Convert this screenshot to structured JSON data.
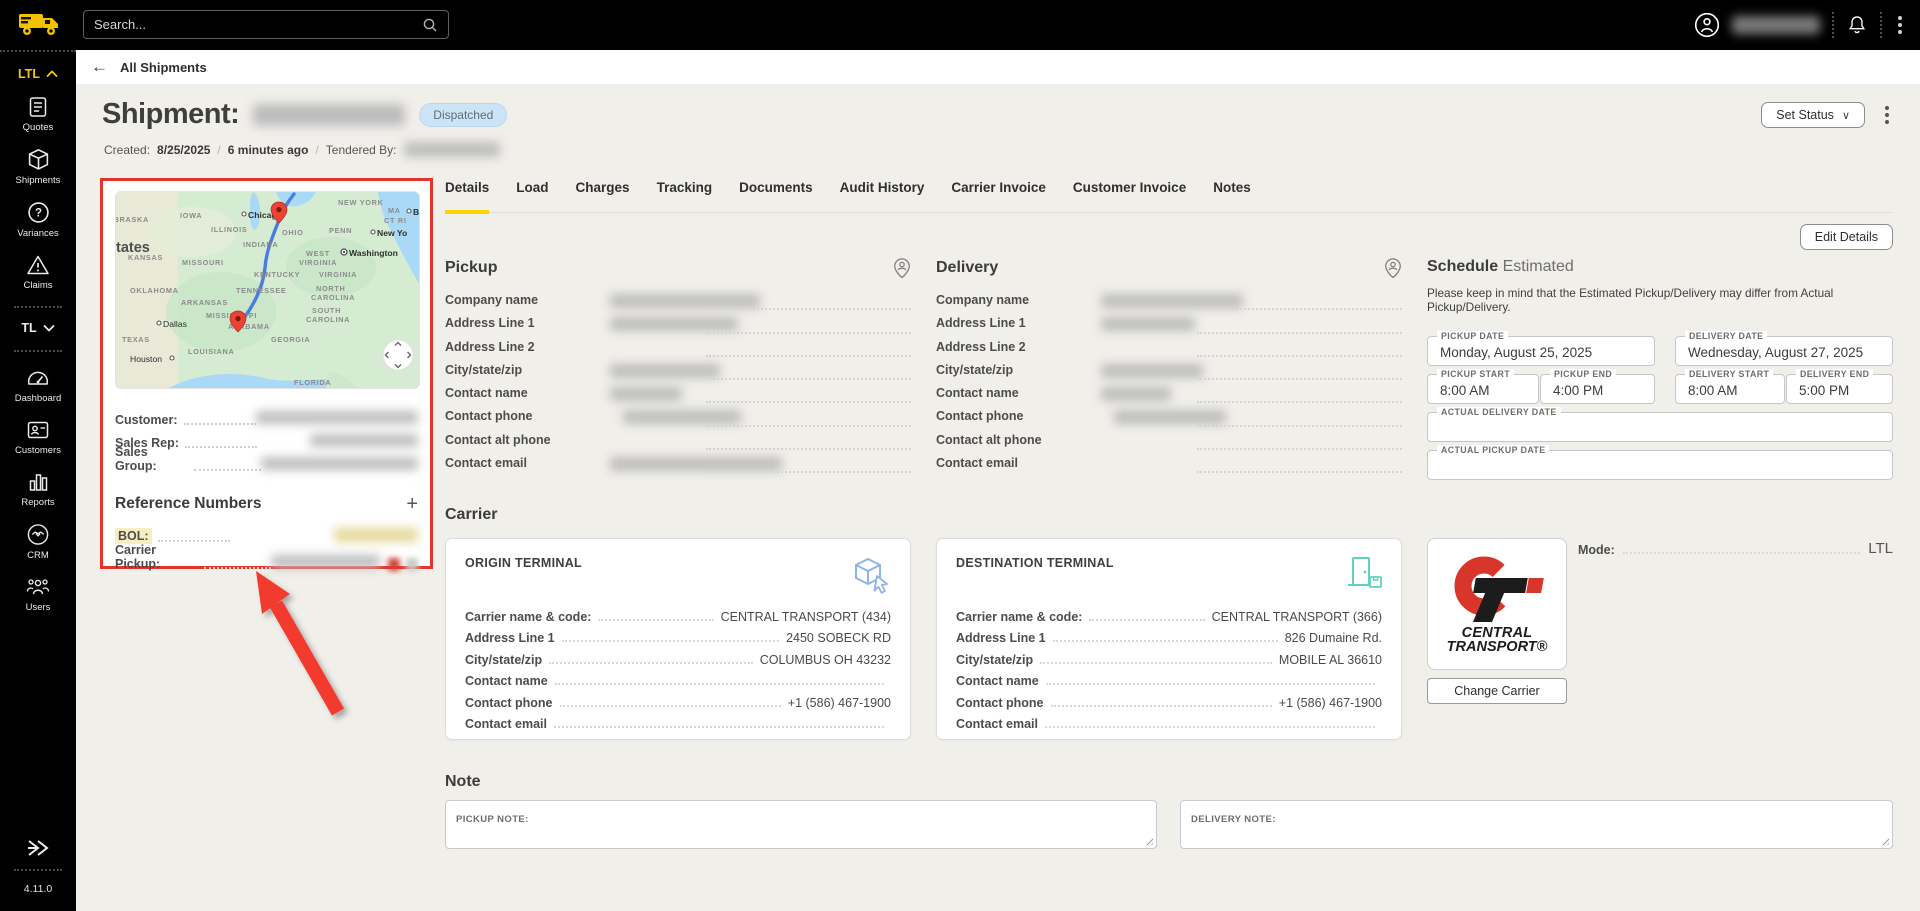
{
  "topbar": {
    "search_placeholder": "Search...",
    "user_redacted": true
  },
  "sidebar": {
    "ltl_label": "LTL",
    "tl_label": "TL",
    "items": [
      {
        "label": "Quotes"
      },
      {
        "label": "Shipments"
      },
      {
        "label": "Variances"
      },
      {
        "label": "Claims"
      },
      {
        "label": "Dashboard"
      },
      {
        "label": "Customers"
      },
      {
        "label": "Reports"
      },
      {
        "label": "CRM"
      },
      {
        "label": "Users"
      }
    ],
    "version": "4.11.0"
  },
  "breadcrumb": {
    "back": "←",
    "label": "All Shipments"
  },
  "header": {
    "title": "Shipment:",
    "id_redacted": true,
    "status_badge": "Dispatched",
    "created_label": "Created:",
    "created_date": "8/25/2025",
    "separator": "/",
    "created_ago": "6 minutes ago",
    "tendered_label": "Tendered By:",
    "set_status_label": "Set Status",
    "set_status_chevron": "∨"
  },
  "tabs": {
    "active": "Details",
    "items": [
      {
        "label": "Details"
      },
      {
        "label": "Load"
      },
      {
        "label": "Charges"
      },
      {
        "label": "Tracking"
      },
      {
        "label": "Documents"
      },
      {
        "label": "Audit History"
      },
      {
        "label": "Carrier Invoice"
      },
      {
        "label": "Customer Invoice"
      },
      {
        "label": "Notes"
      }
    ]
  },
  "details_actions": {
    "edit_details_label": "Edit Details"
  },
  "left_panel": {
    "info_rows": [
      {
        "label": "Customer:",
        "redacted": true
      },
      {
        "label": "Sales Rep:",
        "redacted": true
      },
      {
        "label": "Sales Group:",
        "redacted": true
      }
    ],
    "reference": {
      "title": "Reference Numbers",
      "add_icon": "+",
      "rows": [
        {
          "label": "BOL:",
          "highlight": true,
          "redacted": true
        },
        {
          "label": "Carrier Pickup:",
          "redacted": true
        }
      ]
    }
  },
  "map": {
    "labels": {
      "nebraska": "NEBRASKA",
      "iowa": "IOWA",
      "illinois": "ILLINOIS",
      "indiana": "INDIANA",
      "ohio": "OHIO",
      "penn": "PENN",
      "new_york_state": "NEW YORK",
      "ma": "MA",
      "ct_ri": "CT RI",
      "united_states_cut": "tates",
      "kansas": "KANSAS",
      "missouri": "MISSOURI",
      "west1": "WEST",
      "west2": "VIRGINIA",
      "kentucky": "KENTUCKY",
      "virginia": "VIRGINIA",
      "oklahoma": "OKLAHOMA",
      "tennessee": "TENNESSEE",
      "nc1": "NORTH",
      "nc2": "CAROLINA",
      "arkansas": "ARKANSAS",
      "sc1": "SOUTH",
      "sc2": "CAROLINA",
      "mississippi": "MISSISSIPPI",
      "alabama": "ALABAMA",
      "georgia": "GEORGIA",
      "texas": "TEXAS",
      "louisiana": "LOUISIANA",
      "florida": "FLORIDA"
    },
    "cities": {
      "chicago": "Chicago",
      "washington": "Washington",
      "new_york": "New Yo",
      "boston": "B",
      "dallas": "Dallas",
      "houston": "Houston"
    }
  },
  "pickup": {
    "title": "Pickup",
    "fields": [
      {
        "label": "Company name",
        "redacted": true
      },
      {
        "label": "Address Line 1",
        "redacted": true
      },
      {
        "label": "Address Line 2",
        "redacted": false
      },
      {
        "label": "City/state/zip",
        "redacted": true
      },
      {
        "label": "Contact name",
        "redacted": true
      },
      {
        "label": "Contact phone",
        "redacted": true
      },
      {
        "label": "Contact alt phone",
        "redacted": false
      },
      {
        "label": "Contact email",
        "redacted": true
      }
    ]
  },
  "delivery": {
    "title": "Delivery",
    "fields": [
      {
        "label": "Company name",
        "redacted": true
      },
      {
        "label": "Address Line 1",
        "redacted": true
      },
      {
        "label": "Address Line 2",
        "redacted": false
      },
      {
        "label": "City/state/zip",
        "redacted": true
      },
      {
        "label": "Contact name",
        "redacted": true
      },
      {
        "label": "Contact phone",
        "redacted": true
      },
      {
        "label": "Contact alt phone",
        "redacted": false
      },
      {
        "label": "Contact email",
        "redacted": false
      }
    ]
  },
  "schedule": {
    "title": "Schedule",
    "subtitle": "Estimated",
    "disclaimer": "Please keep in mind that the Estimated Pickup/Delivery may differ from Actual Pickup/Delivery.",
    "pickup_date": {
      "label": "PICKUP DATE",
      "value": "Monday, August 25, 2025"
    },
    "delivery_date": {
      "label": "DELIVERY DATE",
      "value": "Wednesday, August 27, 2025"
    },
    "pickup_start": {
      "label": "PICKUP START",
      "value": "8:00 AM"
    },
    "pickup_end": {
      "label": "PICKUP END",
      "value": "4:00 PM"
    },
    "delivery_start": {
      "label": "DELIVERY START",
      "value": "8:00 AM"
    },
    "delivery_end": {
      "label": "DELIVERY END",
      "value": "5:00 PM"
    },
    "actual_delivery_date": {
      "label": "ACTUAL DELIVERY DATE",
      "value": ""
    },
    "actual_pickup_date": {
      "label": "ACTUAL PICKUP DATE",
      "value": ""
    }
  },
  "carrier": {
    "title": "Carrier",
    "origin": {
      "heading": "ORIGIN TERMINAL",
      "rows": [
        {
          "label": "Carrier name & code:",
          "value": "CENTRAL TRANSPORT (434)"
        },
        {
          "label": "Address Line 1",
          "value": "2450 SOBECK RD"
        },
        {
          "label": "City/state/zip",
          "value": "COLUMBUS OH 43232"
        },
        {
          "label": "Contact name",
          "value": ""
        },
        {
          "label": "Contact phone",
          "value": "+1 (586) 467-1900"
        },
        {
          "label": "Contact email",
          "value": ""
        }
      ]
    },
    "destination": {
      "heading": "DESTINATION TERMINAL",
      "rows": [
        {
          "label": "Carrier name & code:",
          "value": "CENTRAL TRANSPORT (366)"
        },
        {
          "label": "Address Line 1",
          "value": "826 Dumaine Rd."
        },
        {
          "label": "City/state/zip",
          "value": "MOBILE AL 36610"
        },
        {
          "label": "Contact name",
          "value": ""
        },
        {
          "label": "Contact phone",
          "value": "+1 (586) 467-1900"
        },
        {
          "label": "Contact email",
          "value": ""
        }
      ]
    },
    "logo": {
      "line1": "CENTRAL",
      "line2": "TRANSPORT®"
    },
    "change_carrier_label": "Change Carrier",
    "mode_label": "Mode:",
    "mode_value": "LTL"
  },
  "note": {
    "title": "Note",
    "pickup_label": "PICKUP NOTE:",
    "delivery_label": "DELIVERY NOTE:"
  },
  "colors": {
    "accent_yellow": "#ffd400",
    "alert_red": "#e5352b",
    "badge_blue_bg": "#cde4f6",
    "origin_icon_blue": "#8fb4e8",
    "destination_icon_teal": "#5fd2c0",
    "map_route_blue": "#4a7de2",
    "pin_red": "#ea4335",
    "logo_red": "#d8362b"
  }
}
